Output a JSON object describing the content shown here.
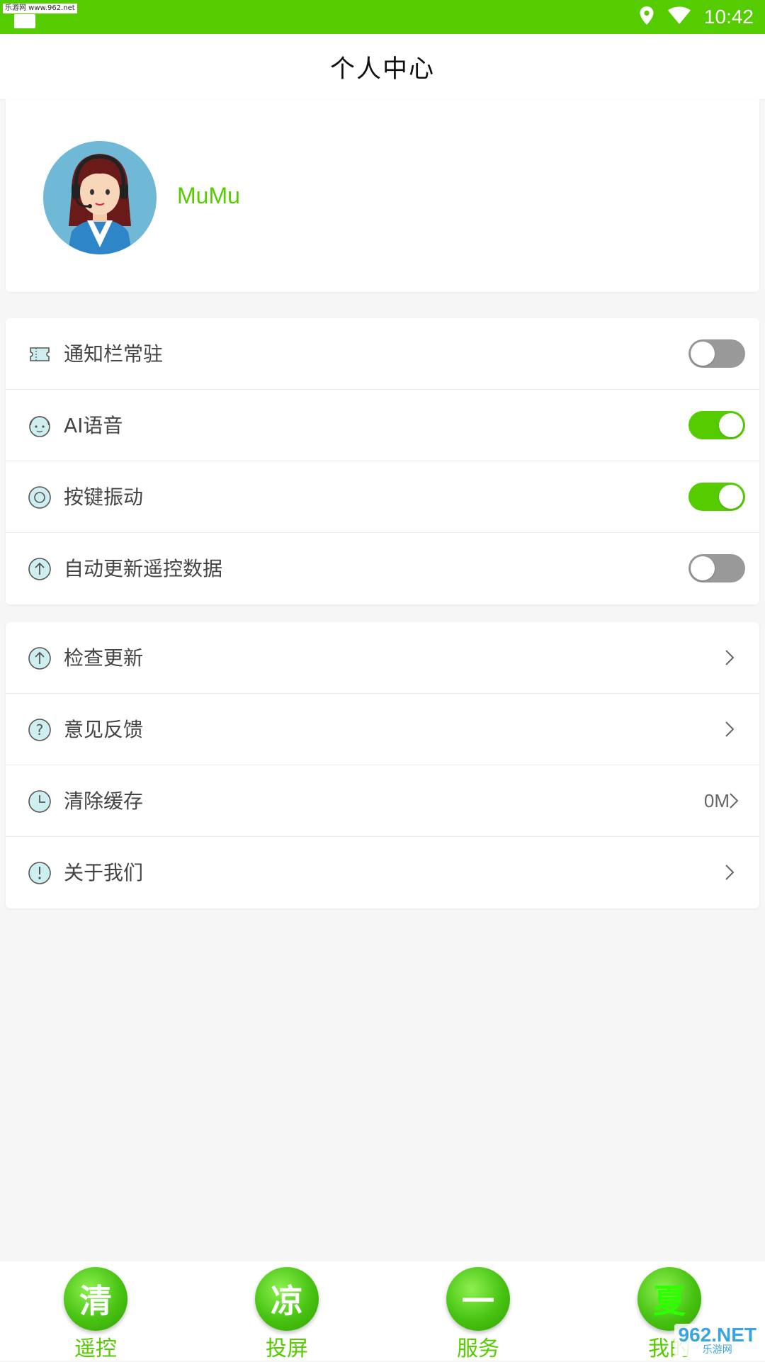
{
  "status_bar": {
    "watermark": "乐游网 www.962.net",
    "time": "10:42",
    "icons": [
      "notification-icon",
      "location-icon",
      "wifi-icon"
    ]
  },
  "header": {
    "title": "个人中心"
  },
  "profile": {
    "username": "MuMu",
    "avatar": "customer-service-avatar"
  },
  "settings": [
    {
      "label": "通知栏常驻",
      "icon": "ticket-icon",
      "toggle": false
    },
    {
      "label": "AI语音",
      "icon": "face-icon",
      "toggle": true
    },
    {
      "label": "按键振动",
      "icon": "vibrate-icon",
      "toggle": true
    },
    {
      "label": "自动更新遥控数据",
      "icon": "upload-icon",
      "toggle": false
    }
  ],
  "menu": [
    {
      "label": "检查更新",
      "icon": "upload-icon",
      "value": ""
    },
    {
      "label": "意见反馈",
      "icon": "question-icon",
      "value": ""
    },
    {
      "label": "清除缓存",
      "icon": "clock-icon",
      "value": "0M"
    },
    {
      "label": "关于我们",
      "icon": "info-icon",
      "value": ""
    }
  ],
  "bottom_nav": [
    {
      "label": "遥控",
      "bubble": "清"
    },
    {
      "label": "投屏",
      "bubble": "凉"
    },
    {
      "label": "服务",
      "bubble": "一"
    },
    {
      "label": "我的",
      "bubble": "夏"
    }
  ],
  "watermark_corner": {
    "big": "962.NET",
    "small": "乐游网"
  },
  "colors": {
    "accent": "#55cc00",
    "toggle_off": "#999999",
    "background": "#f6f6f6"
  }
}
